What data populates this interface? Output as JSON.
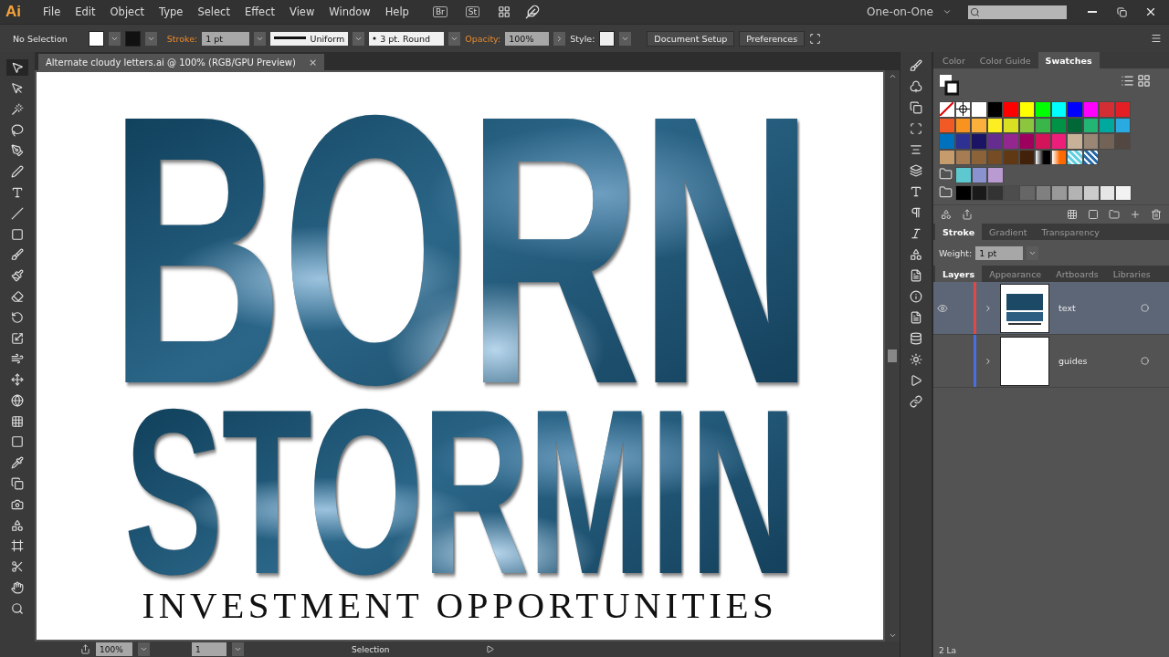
{
  "app_logo": "Ai",
  "menu": [
    "File",
    "Edit",
    "Object",
    "Type",
    "Select",
    "Effect",
    "View",
    "Window",
    "Help"
  ],
  "app_bar_buttons": [
    "Br",
    "St"
  ],
  "workspace": "One-on-One",
  "control_bar": {
    "selection": "No Selection",
    "stroke_label": "Stroke:",
    "stroke_weight": "1 pt",
    "profile": "Uniform",
    "brush": "3 pt. Round",
    "opacity_label": "Opacity:",
    "opacity": "100%",
    "style_label": "Style:",
    "buttons": [
      "Document Setup",
      "Preferences"
    ]
  },
  "document_tab": {
    "title": "Alternate cloudy letters.ai @ 100% (RGB/GPU Preview)",
    "close": "×"
  },
  "artwork": {
    "line_1": "BORN",
    "line_2": "STORMIN",
    "tagline": "INVESTMENT OPPORTUNITIES"
  },
  "swatches_panel": {
    "tabs": [
      {
        "label": "Color",
        "selected": false
      },
      {
        "label": "Color Guide",
        "selected": false
      },
      {
        "label": "Swatches",
        "selected": true
      }
    ],
    "rows": [
      [
        {
          "kind": "none"
        },
        {
          "kind": "registration"
        },
        {
          "kind": "color",
          "color": "#ffffff"
        },
        {
          "kind": "color",
          "color": "#000000"
        },
        {
          "kind": "color",
          "color": "#ff0000"
        },
        {
          "kind": "color",
          "color": "#ffff00"
        },
        {
          "kind": "color",
          "color": "#00ff00"
        },
        {
          "kind": "color",
          "color": "#00ffff"
        },
        {
          "kind": "color",
          "color": "#0000ff"
        },
        {
          "kind": "color",
          "color": "#ff00ff"
        },
        {
          "kind": "color",
          "color": "#d42e35"
        },
        {
          "kind": "color",
          "color": "#e31e24"
        }
      ],
      [
        {
          "kind": "color",
          "color": "#f15a24"
        },
        {
          "kind": "color",
          "color": "#f7931e"
        },
        {
          "kind": "color",
          "color": "#fbb03b"
        },
        {
          "kind": "color",
          "color": "#fcee21"
        },
        {
          "kind": "color",
          "color": "#d9e021"
        },
        {
          "kind": "color",
          "color": "#8cc63f"
        },
        {
          "kind": "color",
          "color": "#39b54a"
        },
        {
          "kind": "color",
          "color": "#009245"
        },
        {
          "kind": "color",
          "color": "#006837"
        },
        {
          "kind": "color",
          "color": "#22b573"
        },
        {
          "kind": "color",
          "color": "#00a99d"
        },
        {
          "kind": "color",
          "color": "#29abe2"
        }
      ],
      [
        {
          "kind": "color",
          "color": "#0071bc"
        },
        {
          "kind": "color",
          "color": "#2e3192"
        },
        {
          "kind": "color",
          "color": "#1b1464"
        },
        {
          "kind": "color",
          "color": "#662d91"
        },
        {
          "kind": "color",
          "color": "#93278f"
        },
        {
          "kind": "color",
          "color": "#9e005d"
        },
        {
          "kind": "color",
          "color": "#d4145a"
        },
        {
          "kind": "color",
          "color": "#ed1e79"
        },
        {
          "kind": "color",
          "color": "#c7b299"
        },
        {
          "kind": "color",
          "color": "#998675"
        },
        {
          "kind": "color",
          "color": "#736357"
        },
        {
          "kind": "color",
          "color": "#534741"
        }
      ],
      [
        {
          "kind": "color",
          "color": "#c69c6d"
        },
        {
          "kind": "color",
          "color": "#a67c52"
        },
        {
          "kind": "color",
          "color": "#8c6239"
        },
        {
          "kind": "color",
          "color": "#754c24"
        },
        {
          "kind": "color",
          "color": "#603813"
        },
        {
          "kind": "color",
          "color": "#42210b"
        },
        {
          "kind": "gradient",
          "color": "#000000"
        },
        {
          "kind": "gradient",
          "color": "#ff6a00"
        },
        {
          "kind": "pattern",
          "color": "#5ed0e0"
        },
        {
          "kind": "pattern",
          "color": "#2a6aa8"
        }
      ]
    ],
    "groups": [
      [
        {
          "kind": "color",
          "color": "#5ec8d0"
        },
        {
          "kind": "color",
          "color": "#8a93d0"
        },
        {
          "kind": "color",
          "color": "#b99ad1"
        }
      ],
      [
        {
          "kind": "color",
          "color": "#000000"
        },
        {
          "kind": "color",
          "color": "#1a1a1a"
        },
        {
          "kind": "color",
          "color": "#333333"
        },
        {
          "kind": "color",
          "color": "#4d4d4d"
        },
        {
          "kind": "color",
          "color": "#666666"
        },
        {
          "kind": "color",
          "color": "#808080"
        },
        {
          "kind": "color",
          "color": "#999999"
        },
        {
          "kind": "color",
          "color": "#b3b3b3"
        },
        {
          "kind": "color",
          "color": "#cccccc"
        },
        {
          "kind": "color",
          "color": "#e6e6e6"
        },
        {
          "kind": "color",
          "color": "#f2f2f2"
        }
      ]
    ]
  },
  "stroke_panel": {
    "tabs": [
      {
        "label": "Stroke",
        "selected": true
      },
      {
        "label": "Gradient",
        "selected": false
      },
      {
        "label": "Transparency",
        "selected": false
      }
    ],
    "weight_label": "Weight:",
    "weight": "1 pt"
  },
  "layers_panel": {
    "tabs": [
      {
        "label": "Layers",
        "selected": true
      },
      {
        "label": "Appearance",
        "selected": false
      },
      {
        "label": "Artboards",
        "selected": false
      },
      {
        "label": "Libraries",
        "selected": false
      }
    ],
    "layers": [
      {
        "name": "text",
        "visible": true,
        "selected": true,
        "color": "#e04848",
        "kind": "art"
      },
      {
        "name": "guides",
        "visible": false,
        "selected": false,
        "color": "#4a6ee0",
        "kind": "blank"
      }
    ],
    "count": "2 La"
  },
  "status_bar": {
    "zoom": "100%",
    "artboard": "1",
    "tool": "Selection"
  }
}
